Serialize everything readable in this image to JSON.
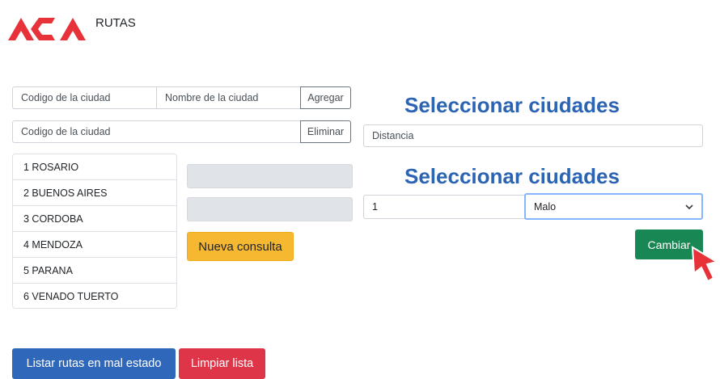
{
  "brand": {
    "title": "RUTAS",
    "logo_color": "#e8323a"
  },
  "add_form": {
    "code_placeholder": "Codigo de la ciudad",
    "name_placeholder": "Nombre de la ciudad",
    "add_label": "Agregar"
  },
  "delete_form": {
    "code_placeholder": "Codigo de la ciudad",
    "delete_label": "Eliminar"
  },
  "cities": [
    {
      "label": "1 ROSARIO"
    },
    {
      "label": "2 BUENOS AIRES"
    },
    {
      "label": "3 CORDOBA"
    },
    {
      "label": "4 MENDOZA"
    },
    {
      "label": "5 PARANA"
    },
    {
      "label": "6 VENADO TUERTO"
    }
  ],
  "query": {
    "new_query_label": "Nueva consulta"
  },
  "distance_section": {
    "heading": "Seleccionar ciudades",
    "distance_placeholder": "Distancia"
  },
  "state_section": {
    "heading": "Seleccionar ciudades",
    "route_value": "1",
    "state_selected": "Malo",
    "change_label": "Cambiar"
  },
  "footer": {
    "list_bad_label": "Listar rutas en mal estado",
    "clear_label": "Limpiar lista"
  },
  "colors": {
    "primary": "#2f68ba",
    "danger": "#df3549",
    "success": "#198754",
    "warning": "#f6b731",
    "heading": "#2b64b3"
  }
}
